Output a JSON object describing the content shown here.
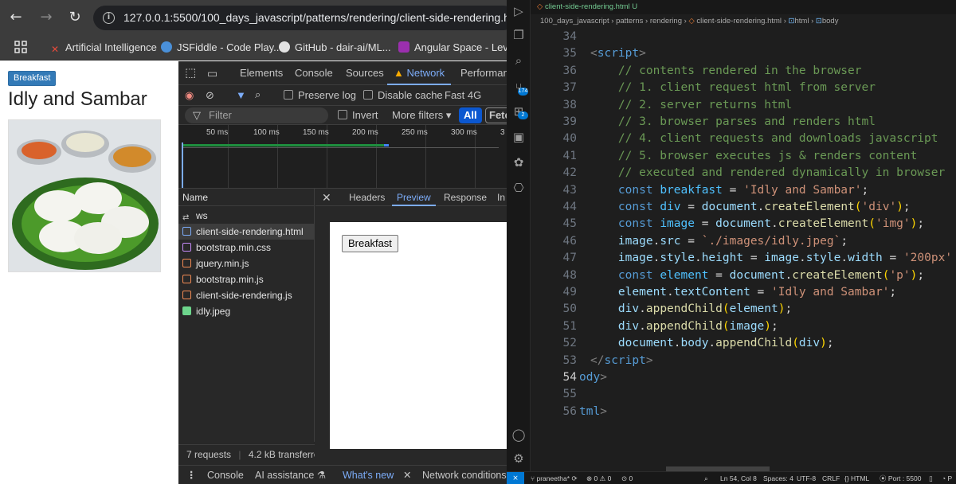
{
  "browser": {
    "url": "127.0.0.1:5500/100_days_javascript/patterns/rendering/client-side-rendering.html",
    "bookmarks": [
      "Artificial Intelligence",
      "JSFiddle - Code Play...",
      "GitHub - dair-ai/ML...",
      "Angular Space - Lev..."
    ],
    "page": {
      "button_label": "Breakfast",
      "heading": "Idly and Sambar"
    }
  },
  "devtools": {
    "tabs": [
      "Elements",
      "Console",
      "Sources",
      "Network",
      "Performanc"
    ],
    "active_tab": "Network",
    "preserve_log": "Preserve log",
    "disable_cache": "Disable cache",
    "throttling": "Fast 4G",
    "filter_placeholder": "Filter",
    "invert": "Invert",
    "more_filters": "More filters",
    "type_all": "All",
    "type_fetch": "Fetc",
    "timeline_ticks": [
      "50 ms",
      "100 ms",
      "150 ms",
      "200 ms",
      "250 ms",
      "300 ms",
      "3"
    ],
    "name_header": "Name",
    "requests": [
      {
        "name": "ws",
        "icon": "ws-icon",
        "color": "#c7c7c7"
      },
      {
        "name": "client-side-rendering.html",
        "icon": "document-icon",
        "color": "#7cacf8"
      },
      {
        "name": "bootstrap.min.css",
        "icon": "css-icon",
        "color": "#c58af9"
      },
      {
        "name": "jquery.min.js",
        "icon": "script-icon",
        "color": "#f28b54"
      },
      {
        "name": "bootstrap.min.js",
        "icon": "script-icon",
        "color": "#f28b54"
      },
      {
        "name": "client-side-rendering.js",
        "icon": "script-icon",
        "color": "#f28b54"
      },
      {
        "name": "idly.jpeg",
        "icon": "image-icon",
        "color": "#6dd58c"
      }
    ],
    "detail_tabs": [
      "Headers",
      "Preview",
      "Response",
      "In"
    ],
    "active_detail_tab": "Preview",
    "preview_button": "Breakfast",
    "requests_count": "7 requests",
    "transferred": "4.2 kB transferrec",
    "drawer": [
      "Console",
      "AI assistance",
      "What's new",
      "Network conditions"
    ]
  },
  "vscode": {
    "tab_title": "client-side-rendering.html",
    "tab_status": "U",
    "breadcrumb": [
      "100_days_javascript",
      "patterns",
      "rendering",
      "client-side-rendering.html",
      "html",
      "body"
    ],
    "line_numbers": [
      "34",
      "35",
      "36",
      "37",
      "38",
      "39",
      "40",
      "41",
      "42",
      "43",
      "44",
      "45",
      "46",
      "47",
      "48",
      "49",
      "50",
      "51",
      "52",
      "53",
      "54",
      "55",
      "56"
    ],
    "current_line": "54",
    "status": {
      "user": "praneetha*",
      "problems": "0",
      "warnings": "0",
      "ports": "0",
      "position": "Ln 54, Col 8",
      "spaces": "Spaces: 4",
      "encoding": "UTF-8",
      "eol": "CRLF",
      "language": "HTML",
      "port": "Port : 5500",
      "extra": "P"
    }
  }
}
